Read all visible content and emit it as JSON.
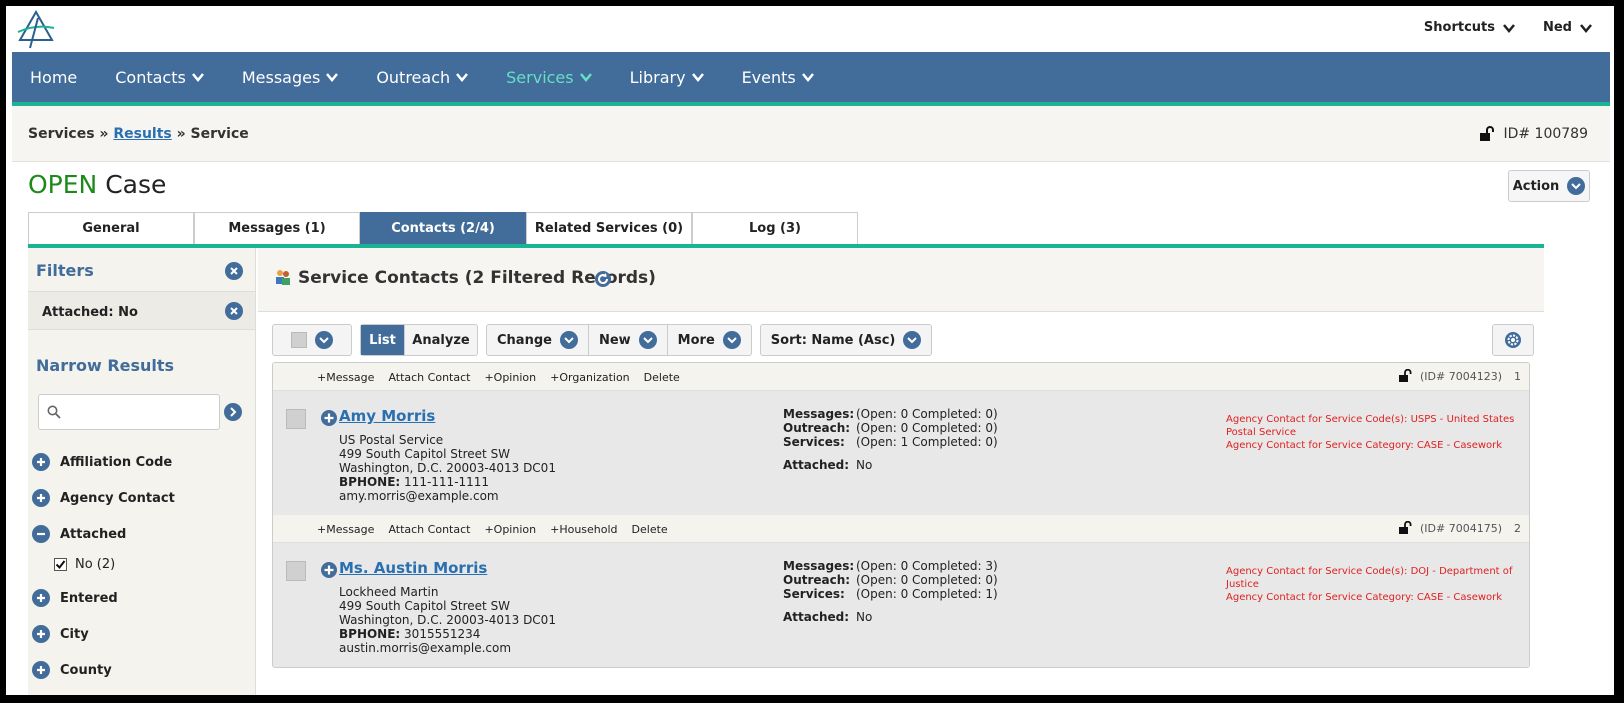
{
  "topbar": {
    "shortcuts": "Shortcuts",
    "user": "Ned"
  },
  "nav": [
    {
      "label": "Home",
      "dropdown": false
    },
    {
      "label": "Contacts",
      "dropdown": true
    },
    {
      "label": "Messages",
      "dropdown": true
    },
    {
      "label": "Outreach",
      "dropdown": true
    },
    {
      "label": "Services",
      "dropdown": true,
      "active": true
    },
    {
      "label": "Library",
      "dropdown": true
    },
    {
      "label": "Events",
      "dropdown": true
    }
  ],
  "breadcrumb": {
    "root": "Services",
    "sep1": " » ",
    "link": "Results",
    "sep2": " » ",
    "current": "Service"
  },
  "record_id": "ID# 100789",
  "title": {
    "status": "OPEN",
    "rest": " Case"
  },
  "action_label": "Action",
  "tabs": [
    {
      "label": "General"
    },
    {
      "label": "Messages (1)"
    },
    {
      "label": "Contacts (2/4)",
      "active": true
    },
    {
      "label": "Related Services (0)"
    },
    {
      "label": "Log (3)"
    }
  ],
  "sidebar": {
    "filters_title": "Filters",
    "active_filter": "Attached: No",
    "narrow_title": "Narrow Results",
    "search_placeholder": "",
    "facets": [
      {
        "label": "Affiliation Code",
        "expanded": false
      },
      {
        "label": "Agency Contact",
        "expanded": false
      },
      {
        "label": "Attached",
        "expanded": true,
        "options": [
          {
            "label": "No (2)",
            "checked": true
          }
        ]
      },
      {
        "label": "Entered",
        "expanded": false
      },
      {
        "label": "City",
        "expanded": false
      },
      {
        "label": "County",
        "expanded": false
      }
    ]
  },
  "main": {
    "title": "Service Contacts (2 Filtered Records)",
    "toolbar": {
      "list": "List",
      "analyze": "Analyze",
      "change": "Change",
      "new": "New",
      "more": "More",
      "sort": "Sort: Name (Asc)"
    },
    "records": [
      {
        "actions": [
          "+Message",
          "Attach Contact",
          "+Opinion",
          "+Organization",
          "Delete"
        ],
        "id": "(ID# 7004123)",
        "index": "1",
        "name": "Amy Morris",
        "lines": [
          "US Postal Service",
          "499 South Capitol Street SW",
          "Washington, D.C. 20003-4013 DC01"
        ],
        "phone_label": "BPHONE:",
        "phone": " 111-111-1111",
        "email": "amy.morris@example.com",
        "stats": [
          {
            "k": "Messages:",
            "v": "(Open: 0 Completed: 0)"
          },
          {
            "k": "Outreach:",
            "v": "(Open: 0 Completed: 0)"
          },
          {
            "k": "Services:",
            "v": "(Open: 1 Completed: 0)"
          }
        ],
        "attached_label": "Attached:",
        "attached": "No",
        "notes": [
          "Agency Contact for Service Code(s): USPS - United States Postal Service",
          "Agency Contact for Service Category: CASE - Casework"
        ]
      },
      {
        "actions": [
          "+Message",
          "Attach Contact",
          "+Opinion",
          "+Household",
          "Delete"
        ],
        "id": "(ID# 7004175)",
        "index": "2",
        "name": "Ms. Austin Morris",
        "lines": [
          "Lockheed Martin",
          "499 South Capitol Street SW",
          "Washington, D.C. 20003-4013 DC01"
        ],
        "phone_label": "BPHONE:",
        "phone": " 3015551234",
        "email": "austin.morris@example.com",
        "stats": [
          {
            "k": "Messages:",
            "v": "(Open: 0 Completed: 3)"
          },
          {
            "k": "Outreach:",
            "v": "(Open: 0 Completed: 0)"
          },
          {
            "k": "Services:",
            "v": "(Open: 0 Completed: 1)"
          }
        ],
        "attached_label": "Attached:",
        "attached": "No",
        "notes": [
          "Agency Contact for Service Code(s): DOJ - Department of Justice",
          "Agency Contact for Service Category: CASE - Casework"
        ]
      }
    ]
  },
  "colors": {
    "nav": "#426c99",
    "accent": "#1ab394",
    "link": "#2a6fb0",
    "open": "#1e8a1e",
    "note": "#e02020"
  }
}
